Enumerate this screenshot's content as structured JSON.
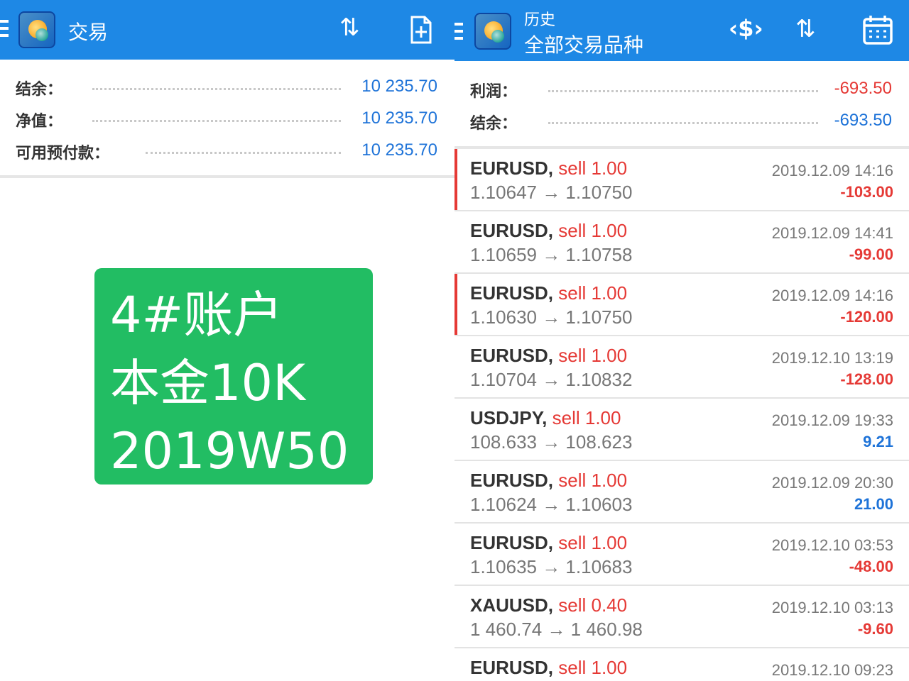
{
  "trade_screen": {
    "title": "交易",
    "icons": [
      "menu-icon",
      "app-logo-icon",
      "sort-icon",
      "new-order-icon"
    ],
    "summary": [
      {
        "label": "结余：",
        "value": "10 235.70"
      },
      {
        "label": "净值：",
        "value": "10 235.70"
      },
      {
        "label": "可用预付款：",
        "value": "10 235.70"
      }
    ]
  },
  "promo_card": {
    "line1": "4#账户",
    "line2": "本金10K",
    "line3": "2019W50"
  },
  "history_screen": {
    "title": "历史",
    "subtitle": "全部交易品种",
    "icons": [
      "menu-icon",
      "app-logo-icon",
      "deposit-icon",
      "sort-icon",
      "calendar-icon"
    ],
    "summary": [
      {
        "label": "利润：",
        "value": "-693.50"
      },
      {
        "label": "结余：",
        "value": "-693.50"
      }
    ],
    "trades": [
      {
        "symbol": "EURUSD,",
        "side": "sell 1.00",
        "prices": "1.10647 → 1.10750",
        "time": "2019.12.09 14:16",
        "profit": "-103.00"
      },
      {
        "symbol": "EURUSD,",
        "side": "sell 1.00",
        "prices": "1.10659 → 1.10758",
        "time": "2019.12.09 14:41",
        "profit": "-99.00"
      },
      {
        "symbol": "EURUSD,",
        "side": "sell 1.00",
        "prices": "1.10630 → 1.10750",
        "time": "2019.12.09 14:16",
        "profit": "-120.00"
      },
      {
        "symbol": "EURUSD,",
        "side": "sell 1.00",
        "prices": "1.10704 → 1.10832",
        "time": "2019.12.10 13:19",
        "profit": "-128.00"
      },
      {
        "symbol": "USDJPY,",
        "side": "sell 1.00",
        "prices": "108.633 → 108.623",
        "time": "2019.12.09 19:33",
        "profit": "9.21"
      },
      {
        "symbol": "EURUSD,",
        "side": "sell 1.00",
        "prices": "1.10624 → 1.10603",
        "time": "2019.12.09 20:30",
        "profit": "21.00"
      },
      {
        "symbol": "EURUSD,",
        "side": "sell 1.00",
        "prices": "1.10635 → 1.10683",
        "time": "2019.12.10 03:53",
        "profit": "-48.00"
      },
      {
        "symbol": "XAUUSD,",
        "side": "sell 0.40",
        "prices": "1 460.74 → 1 460.98",
        "time": "2019.12.10 03:13",
        "profit": "-9.60"
      },
      {
        "symbol": "EURUSD,",
        "side": "sell 1.00",
        "prices": "",
        "time": "2019.12.10 09:23",
        "profit": ""
      }
    ]
  },
  "colors": {
    "toolbar": "#1e88e5",
    "loss": "#e53935",
    "gain": "#1e73d8",
    "promo_bg": "#22bd63"
  }
}
